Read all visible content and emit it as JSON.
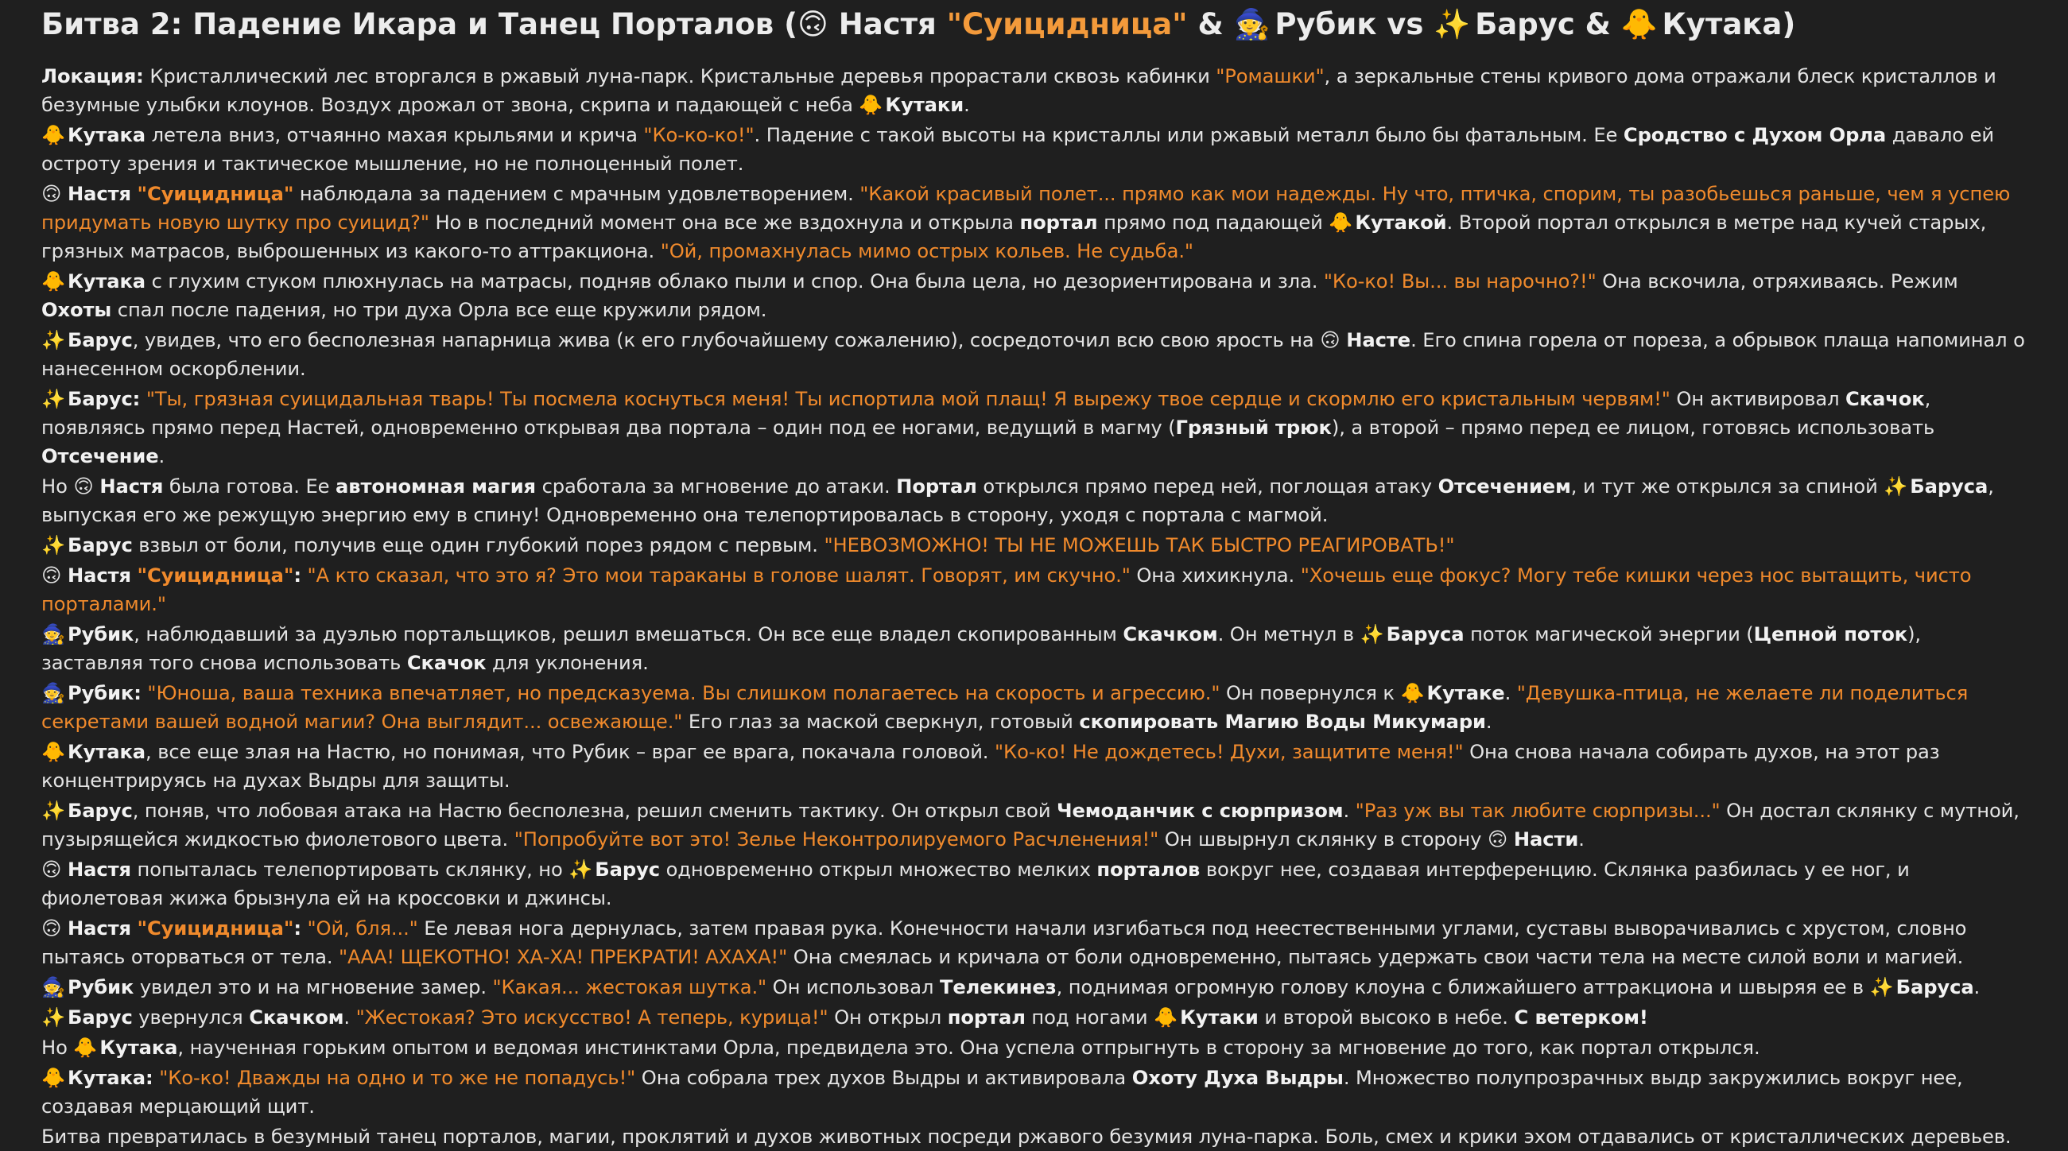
{
  "title": [
    {
      "t": "Битва 2: Падение Икара и Танец Порталов ("
    },
    {
      "e": "🙃",
      "n": "upside-down-face-icon"
    },
    {
      "t": " Настя "
    },
    {
      "q": "\"Суицидница\""
    },
    {
      "t": " & "
    },
    {
      "e": "🧙",
      "n": "mage-icon"
    },
    {
      "t": " Рубик vs "
    },
    {
      "e": "✨",
      "n": "sparkles-icon"
    },
    {
      "t": " Барус & "
    },
    {
      "e": "🐥",
      "n": "chick-icon"
    },
    {
      "t": " Кутака)"
    }
  ],
  "paragraphs": [
    [
      {
        "b": "Локация:"
      },
      {
        "t": " Кристаллический лес вторгался в ржавый луна-парк. Кристальные деревья прорастали сквозь кабинки "
      },
      {
        "q": "\"Ромашки\""
      },
      {
        "t": ", а зеркальные стены кривого дома отражали блеск кристаллов и безумные улыбки клоунов. Воздух дрожал от звона, скрипа и падающей с неба "
      },
      {
        "e": "🐥",
        "n": "chick-icon"
      },
      {
        "t": " "
      },
      {
        "b": "Кутаки"
      },
      {
        "t": "."
      }
    ],
    [
      {
        "e": "🐥",
        "n": "chick-icon"
      },
      {
        "t": " "
      },
      {
        "b": "Кутака"
      },
      {
        "t": " летела вниз, отчаянно махая крыльями и крича "
      },
      {
        "q": "\"Ко-ко-ко!\""
      },
      {
        "t": ". Падение с такой высоты на кристаллы или ржавый металл было бы фатальным. Ее "
      },
      {
        "b": "Сродство с Духом Орла"
      },
      {
        "t": " давало ей остроту зрения и тактическое мышление, но не полноценный полет."
      }
    ],
    [
      {
        "e": "🙃",
        "n": "upside-down-face-icon"
      },
      {
        "t": " "
      },
      {
        "b": "Настя"
      },
      {
        "t": " "
      },
      {
        "qb": "\"Суицидница\""
      },
      {
        "t": " наблюдала за падением с мрачным удовлетворением. "
      },
      {
        "q": "\"Какой красивый полет... прямо как мои надежды. Ну что, птичка, спорим, ты разобьешься раньше, чем я успею придумать новую шутку про суицид?\""
      },
      {
        "t": " Но в последний момент она все же вздохнула и открыла "
      },
      {
        "b": "портал"
      },
      {
        "t": " прямо под падающей "
      },
      {
        "e": "🐥",
        "n": "chick-icon"
      },
      {
        "t": " "
      },
      {
        "b": "Кутакой"
      },
      {
        "t": ". Второй портал открылся в метре над кучей старых, грязных матрасов, выброшенных из какого-то аттракциона. "
      },
      {
        "q": "\"Ой, промахнулась мимо острых кольев. Не судьба.\""
      }
    ],
    [
      {
        "e": "🐥",
        "n": "chick-icon"
      },
      {
        "t": " "
      },
      {
        "b": "Кутака"
      },
      {
        "t": " с глухим стуком плюхнулась на матрасы, подняв облако пыли и спор. Она была цела, но дезориентирована и зла. "
      },
      {
        "q": "\"Ко-ко! Вы... вы нарочно?!\""
      },
      {
        "t": " Она вскочила, отряхиваясь. Режим "
      },
      {
        "b": "Охоты"
      },
      {
        "t": " спал после падения, но три духа Орла все еще кружили рядом."
      }
    ],
    [
      {
        "e": "✨",
        "n": "sparkles-icon"
      },
      {
        "t": " "
      },
      {
        "b": "Барус"
      },
      {
        "t": ", увидев, что его бесполезная напарница жива (к его глубочайшему сожалению), сосредоточил всю свою ярость на "
      },
      {
        "e": "🙃",
        "n": "upside-down-face-icon"
      },
      {
        "t": " "
      },
      {
        "b": "Насте"
      },
      {
        "t": ". Его спина горела от пореза, а обрывок плаща напоминал о нанесенном оскорблении."
      }
    ],
    [
      {
        "e": "✨",
        "n": "sparkles-icon"
      },
      {
        "t": " "
      },
      {
        "b": "Барус:"
      },
      {
        "t": " "
      },
      {
        "q": "\"Ты, грязная суицидальная тварь! Ты посмела коснуться меня! Ты испортила мой плащ! Я вырежу твое сердце и скормлю его кристальным червям!\""
      },
      {
        "t": " Он активировал "
      },
      {
        "b": "Скачок"
      },
      {
        "t": ", появляясь прямо перед Настей, одновременно открывая два портала – один под ее ногами, ведущий в магму ("
      },
      {
        "b": "Грязный трюк"
      },
      {
        "t": "), а второй – прямо перед ее лицом, готовясь использовать "
      },
      {
        "b": "Отсечение"
      },
      {
        "t": "."
      }
    ],
    [
      {
        "t": "Но "
      },
      {
        "e": "🙃",
        "n": "upside-down-face-icon"
      },
      {
        "t": " "
      },
      {
        "b": "Настя"
      },
      {
        "t": " была готова. Ее "
      },
      {
        "b": "автономная магия"
      },
      {
        "t": " сработала за мгновение до атаки. "
      },
      {
        "b": "Портал"
      },
      {
        "t": " открылся прямо перед ней, поглощая атаку "
      },
      {
        "b": "Отсечением"
      },
      {
        "t": ", и тут же открылся за спиной "
      },
      {
        "e": "✨",
        "n": "sparkles-icon"
      },
      {
        "t": " "
      },
      {
        "b": "Баруса"
      },
      {
        "t": ", выпуская его же режущую энергию ему в спину! Одновременно она телепортировалась в сторону, уходя с портала с магмой."
      }
    ],
    [
      {
        "e": "✨",
        "n": "sparkles-icon"
      },
      {
        "t": " "
      },
      {
        "b": "Барус"
      },
      {
        "t": " взвыл от боли, получив еще один глубокий порез рядом с первым. "
      },
      {
        "q": "\"НЕВОЗМОЖНО! ТЫ НЕ МОЖЕШЬ ТАК БЫСТРО РЕАГИРОВАТЬ!\""
      }
    ],
    [
      {
        "e": "🙃",
        "n": "upside-down-face-icon"
      },
      {
        "t": " "
      },
      {
        "b": "Настя"
      },
      {
        "t": " "
      },
      {
        "qb": "\"Суицидница\""
      },
      {
        "b": ":"
      },
      {
        "t": " "
      },
      {
        "q": "\"А кто сказал, что это я? Это мои тараканы в голове шалят. Говорят, им скучно.\""
      },
      {
        "t": " Она хихикнула. "
      },
      {
        "q": "\"Хочешь еще фокус? Могу тебе кишки через нос вытащить, чисто порталами.\""
      }
    ],
    [
      {
        "e": "🧙",
        "n": "mage-icon"
      },
      {
        "t": " "
      },
      {
        "b": "Рубик"
      },
      {
        "t": ", наблюдавший за дуэлью портальщиков, решил вмешаться. Он все еще владел скопированным "
      },
      {
        "b": "Скачком"
      },
      {
        "t": ". Он метнул в "
      },
      {
        "e": "✨",
        "n": "sparkles-icon"
      },
      {
        "t": " "
      },
      {
        "b": "Баруса"
      },
      {
        "t": " поток магической энергии ("
      },
      {
        "b": "Цепной поток"
      },
      {
        "t": "), заставляя того снова использовать "
      },
      {
        "b": "Скачок"
      },
      {
        "t": " для уклонения."
      }
    ],
    [
      {
        "e": "🧙",
        "n": "mage-icon"
      },
      {
        "t": " "
      },
      {
        "b": "Рубик:"
      },
      {
        "t": " "
      },
      {
        "q": "\"Юноша, ваша техника впечатляет, но предсказуема. Вы слишком полагаетесь на скорость и агрессию.\""
      },
      {
        "t": " Он повернулся к "
      },
      {
        "e": "🐥",
        "n": "chick-icon"
      },
      {
        "t": " "
      },
      {
        "b": "Кутаке"
      },
      {
        "t": ". "
      },
      {
        "q": "\"Девушка-птица, не желаете ли поделиться секретами вашей водной магии? Она выглядит... освежающе.\""
      },
      {
        "t": " Его глаз за маской сверкнул, готовый "
      },
      {
        "b": "скопировать Магию Воды Микумари"
      },
      {
        "t": "."
      }
    ],
    [
      {
        "e": "🐥",
        "n": "chick-icon"
      },
      {
        "t": " "
      },
      {
        "b": "Кутака"
      },
      {
        "t": ", все еще злая на Настю, но понимая, что Рубик – враг ее врага, покачала головой. "
      },
      {
        "q": "\"Ко-ко! Не дождетесь! Духи, защитите меня!\""
      },
      {
        "t": " Она снова начала собирать духов, на этот раз концентрируясь на духах Выдры для защиты."
      }
    ],
    [
      {
        "e": "✨",
        "n": "sparkles-icon"
      },
      {
        "t": " "
      },
      {
        "b": "Барус"
      },
      {
        "t": ", поняв, что лобовая атака на Настю бесполезна, решил сменить тактику. Он открыл свой "
      },
      {
        "b": "Чемоданчик с сюрпризом"
      },
      {
        "t": ". "
      },
      {
        "q": "\"Раз уж вы так любите сюрпризы...\""
      },
      {
        "t": " Он достал склянку с мутной, пузырящейся жидкостью фиолетового цвета. "
      },
      {
        "q": "\"Попробуйте вот это! Зелье Неконтролируемого Расчленения!\""
      },
      {
        "t": " Он швырнул склянку в сторону "
      },
      {
        "e": "🙃",
        "n": "upside-down-face-icon"
      },
      {
        "t": " "
      },
      {
        "b": "Насти"
      },
      {
        "t": "."
      }
    ],
    [
      {
        "e": "🙃",
        "n": "upside-down-face-icon"
      },
      {
        "t": " "
      },
      {
        "b": "Настя"
      },
      {
        "t": " попыталась телепортировать склянку, но "
      },
      {
        "e": "✨",
        "n": "sparkles-icon"
      },
      {
        "t": " "
      },
      {
        "b": "Барус"
      },
      {
        "t": " одновременно открыл множество мелких "
      },
      {
        "b": "порталов"
      },
      {
        "t": " вокруг нее, создавая интерференцию. Склянка разбилась у ее ног, и фиолетовая жижа брызнула ей на кроссовки и джинсы."
      }
    ],
    [
      {
        "e": "🙃",
        "n": "upside-down-face-icon"
      },
      {
        "t": " "
      },
      {
        "b": "Настя"
      },
      {
        "t": " "
      },
      {
        "qb": "\"Суицидница\""
      },
      {
        "b": ":"
      },
      {
        "t": " "
      },
      {
        "q": "\"Ой, бля...\""
      },
      {
        "t": " Ее левая нога дернулась, затем правая рука. Конечности начали изгибаться под неестественными углами, суставы выворачивались с хрустом, словно пытаясь оторваться от тела. "
      },
      {
        "q": "\"ААА! ЩЕКОТНО! ХА-ХА! ПРЕКРАТИ! АХАХА!\""
      },
      {
        "t": " Она смеялась и кричала от боли одновременно, пытаясь удержать свои части тела на месте силой воли и магией."
      }
    ],
    [
      {
        "e": "🧙",
        "n": "mage-icon"
      },
      {
        "t": " "
      },
      {
        "b": "Рубик"
      },
      {
        "t": " увидел это и на мгновение замер. "
      },
      {
        "q": "\"Какая... жестокая шутка.\""
      },
      {
        "t": " Он использовал "
      },
      {
        "b": "Телекинез"
      },
      {
        "t": ", поднимая огромную голову клоуна с ближайшего аттракциона и швыряя ее в "
      },
      {
        "e": "✨",
        "n": "sparkles-icon"
      },
      {
        "t": " "
      },
      {
        "b": "Баруса"
      },
      {
        "t": "."
      }
    ],
    [
      {
        "e": "✨",
        "n": "sparkles-icon"
      },
      {
        "t": " "
      },
      {
        "b": "Барус"
      },
      {
        "t": " увернулся "
      },
      {
        "b": "Скачком"
      },
      {
        "t": ". "
      },
      {
        "q": "\"Жестокая? Это искусство! А теперь, курица!\""
      },
      {
        "t": " Он открыл "
      },
      {
        "b": "портал"
      },
      {
        "t": " под ногами "
      },
      {
        "e": "🐥",
        "n": "chick-icon"
      },
      {
        "t": " "
      },
      {
        "b": "Кутаки"
      },
      {
        "t": " и второй высоко в небе. "
      },
      {
        "b": "С ветерком!"
      }
    ],
    [
      {
        "t": "Но "
      },
      {
        "e": "🐥",
        "n": "chick-icon"
      },
      {
        "t": " "
      },
      {
        "b": "Кутака"
      },
      {
        "t": ", наученная горьким опытом и ведомая инстинктами Орла, предвидела это. Она успела отпрыгнуть в сторону за мгновение до того, как портал открылся."
      }
    ],
    [
      {
        "e": "🐥",
        "n": "chick-icon"
      },
      {
        "t": " "
      },
      {
        "b": "Кутака:"
      },
      {
        "t": " "
      },
      {
        "q": "\"Ко-ко! Дважды на одно и то же не попадусь!\""
      },
      {
        "t": " Она собрала трех духов Выдры и активировала "
      },
      {
        "b": "Охоту Духа Выдры"
      },
      {
        "t": ". Множество полупрозрачных выдр закружились вокруг нее, создавая мерцающий щит."
      }
    ],
    [
      {
        "t": "Битва превратилась в безумный танец порталов, магии, проклятий и духов животных посреди ржавого безумия луна-парка. Боль, смех и крики эхом отдавались от кристаллических деревьев."
      }
    ]
  ]
}
